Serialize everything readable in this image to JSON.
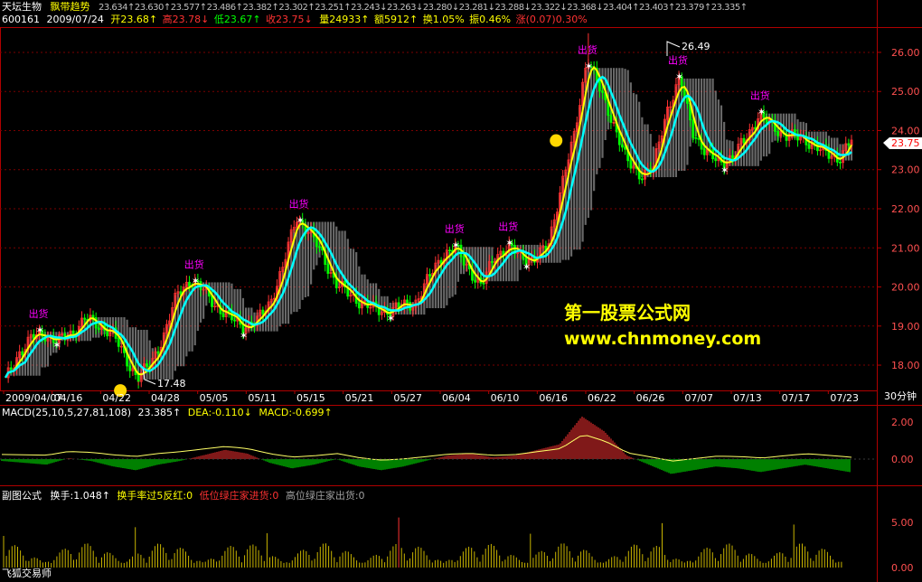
{
  "header": {
    "stock_name": "天坛生物",
    "indicator_name": "飘带趋势",
    "indicator_values": "23.634↑23.630↑23.577↑23.486↑23.382↑23.302↑23.251↑23.243↓23.263↓23.280↓23.281↓23.288↓23.322↓23.368↓23.404↑23.403↑23.379↑23.335↑",
    "code": "600161",
    "date": "2009/07/24",
    "open": "开23.68↑",
    "high": "高23.78↓",
    "low": "低23.67↑",
    "close": "收23.75↓",
    "volume": "量24933↑",
    "amount": "额5912↑",
    "turnover": "换1.05%",
    "amplitude": "振0.46%",
    "change": "涨(0.07)0.30%"
  },
  "colors": {
    "up": "#ff3232",
    "down": "#00ff00",
    "label": "#ff00ff",
    "ma_fast": "#ffff00",
    "ma_slow": "#00ffff",
    "ribbon": "#bdbdbd",
    "axis": "#b00000",
    "watermark": "#ffff00"
  },
  "price_panel": {
    "ylim": [
      17.4,
      26.6
    ],
    "y_ticks": [
      "18.00",
      "19.00",
      "20.00",
      "21.00",
      "22.00",
      "23.00",
      "24.00",
      "25.00",
      "26.00"
    ],
    "current_price": "23.75",
    "high_label": "26.49",
    "low_label": "17.48",
    "sell_signal": "出货",
    "period": "30分钟",
    "x_labels": [
      "2009/04/07",
      "04/16",
      "04/22",
      "04/28",
      "05/05",
      "05/11",
      "05/15",
      "05/21",
      "05/27",
      "06/04",
      "06/10",
      "06/16",
      "06/22",
      "06/26",
      "07/07",
      "07/13",
      "07/17",
      "07/23"
    ]
  },
  "watermark": {
    "line1": "第一股票公式网",
    "line2": "www.chnmoney.com"
  },
  "macd_panel": {
    "title": "MACD(25,10,5,27,81,108)",
    "macd_value": "23.385↑",
    "dea": "DEA:-0.110↓",
    "macd": "MACD:-0.699↑",
    "y_ticks": [
      "2.00",
      "0.00"
    ]
  },
  "sub_panel": {
    "title": "副图公式",
    "turnover": "换手:1.048↑",
    "flag1": "换手率过5反红:0",
    "flag2": "低位绿庄家进货:0",
    "flag3": "高位绿庄家出货:0",
    "y_ticks": [
      "5.00",
      "0.00"
    ],
    "footer": "飞狐交易师"
  },
  "chart_data": {
    "type": "candlestick",
    "x_labels": [
      "2009/04/07",
      "04/16",
      "04/22",
      "04/28",
      "05/05",
      "05/11",
      "05/15",
      "05/21",
      "05/27",
      "06/04",
      "06/10",
      "06/16",
      "06/22",
      "06/26",
      "07/07",
      "07/13",
      "07/17",
      "07/23"
    ],
    "close_path": [
      17.6,
      18.3,
      18.7,
      18.8,
      18.6,
      18.8,
      19.2,
      19.0,
      18.9,
      18.2,
      17.7,
      18.0,
      18.8,
      19.8,
      20.2,
      19.9,
      19.5,
      19.2,
      19.0,
      19.1,
      19.6,
      20.5,
      21.8,
      21.4,
      20.8,
      20.1,
      19.8,
      19.6,
      19.4,
      19.4,
      19.5,
      19.6,
      20.2,
      20.8,
      21.0,
      20.5,
      20.0,
      20.8,
      21.0,
      20.8,
      20.7,
      21.0,
      22.5,
      23.8,
      25.9,
      25.0,
      24.2,
      23.2,
      22.9,
      23.0,
      24.5,
      25.3,
      24.0,
      23.4,
      23.2,
      23.3,
      23.8,
      24.4,
      24.1,
      23.9,
      23.8,
      23.7,
      23.4,
      23.3,
      23.75
    ],
    "high": 26.49,
    "low": 17.48,
    "last_close": 23.75,
    "ylim": [
      17.4,
      26.6
    ],
    "macd": [
      -0.1,
      -0.2,
      -0.3,
      0.05,
      -0.1,
      -0.4,
      -0.6,
      -0.3,
      -0.1,
      0.2,
      0.5,
      0.3,
      -0.2,
      -0.5,
      -0.3,
      0.0,
      -0.4,
      -0.6,
      -0.4,
      -0.1,
      0.2,
      0.3,
      0.1,
      0.2,
      0.5,
      0.8,
      2.3,
      1.5,
      0.2,
      -0.3,
      -0.8,
      -0.6,
      -0.4,
      -0.5,
      -0.7,
      -0.5,
      -0.3,
      -0.5,
      -0.7
    ],
    "macd_ylim": [
      -1.1,
      2.8
    ],
    "turnover_ylim": [
      0,
      8
    ]
  }
}
